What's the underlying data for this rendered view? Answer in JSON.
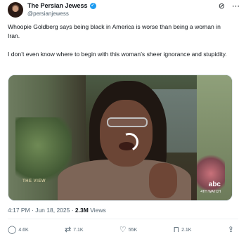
{
  "author": {
    "name": "The Persian Jewess",
    "handle": "@persianjewess",
    "verified_icon": "verified-badge-icon",
    "verified_color": "#1d9bf0"
  },
  "header_icons": [
    "grok-icon",
    "more-icon"
  ],
  "tweet": {
    "paragraph1": "Whoopie Goldberg says being black in America is worse than being a woman in Iran.",
    "paragraph2": "I don’t even know where to begin with this woman’s sheer ignorance and stupidity."
  },
  "media": {
    "watermark_left": "THE VIEW",
    "watermark_right": "abc",
    "watermark_right_sub": "4TH WATCH"
  },
  "meta": {
    "time": "4:17 PM · Jun 18, 2025 · ",
    "views_count": "2.3M",
    "views_label": " Views"
  },
  "actions": {
    "replies": "4.6K",
    "retweets": "7.1K",
    "likes": "55K",
    "bookmarks": "2.1K"
  }
}
